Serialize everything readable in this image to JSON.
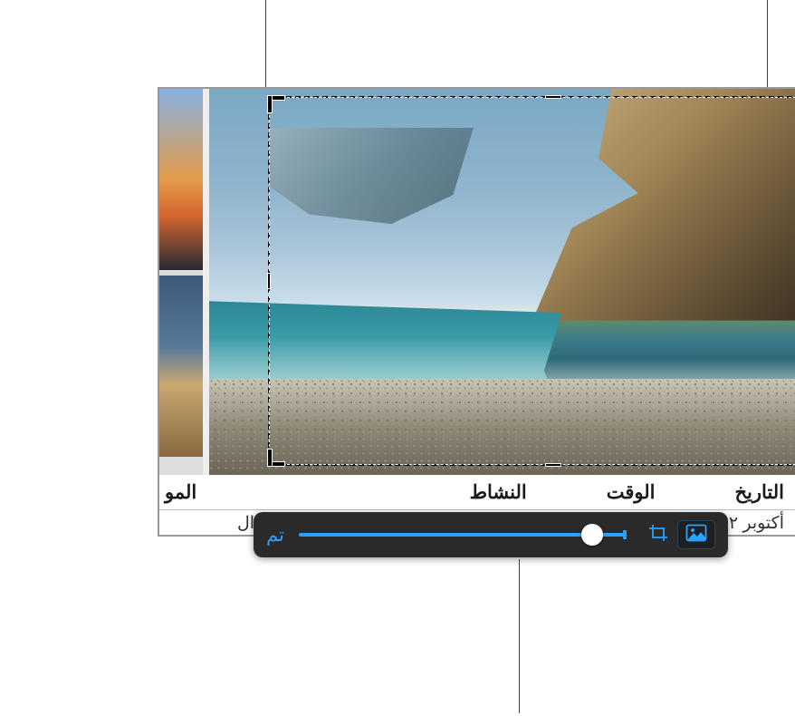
{
  "columns": {
    "date": "التاريخ",
    "time": "الوقت",
    "activity": "النشاط",
    "location": "المو"
  },
  "row": {
    "date": "أكتوبر ٢",
    "location": "شرم ال"
  },
  "toolbar": {
    "done": "تم"
  },
  "icons": {
    "crop": "crop-icon",
    "image": "image-icon"
  },
  "colors": {
    "accent": "#2aa2ff"
  }
}
